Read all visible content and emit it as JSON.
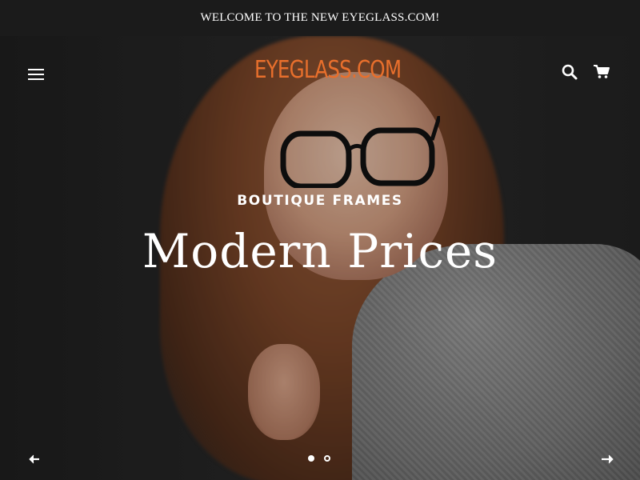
{
  "announcement": {
    "text": "WELCOME TO THE NEW EYEGLASS.COM!"
  },
  "header": {
    "logo_text": "EYEGLASS.COM",
    "logo_color": "#e86f2c",
    "menu_icon": "hamburger-menu-icon",
    "search_icon": "search-icon",
    "cart_icon": "shopping-cart-icon"
  },
  "slideshow": {
    "subtitle": "BOUTIQUE FRAMES",
    "title": "Modern Prices",
    "prev_icon": "arrow-left-icon",
    "next_icon": "arrow-right-icon",
    "slide_count": 2,
    "active_slide": 1
  }
}
